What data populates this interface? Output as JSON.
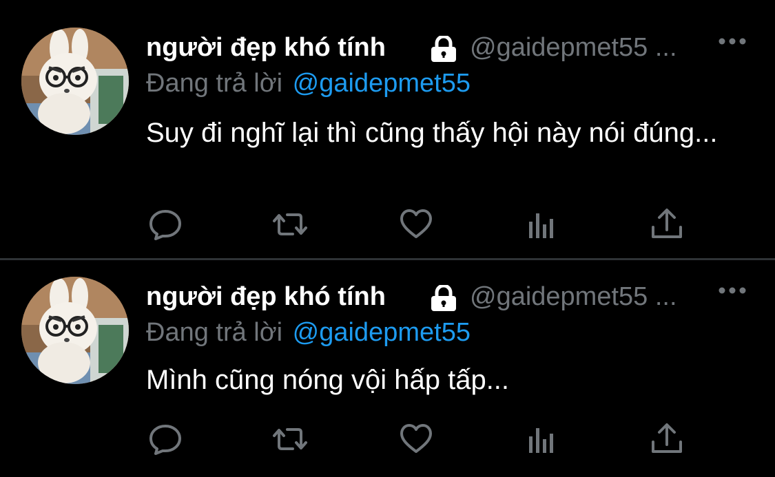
{
  "tweets": [
    {
      "author_name": "người đẹp khó tính",
      "handle": "@gaidepmet55 ...",
      "reply_prefix": "Đang trả lời",
      "reply_mention": "@gaidepmet55",
      "text": "Suy đi nghĩ lại thì cũng thấy hội này nói đúng..."
    },
    {
      "author_name": "người đẹp khó tính",
      "handle": "@gaidepmet55 ...",
      "reply_prefix": "Đang trả lời",
      "reply_mention": "@gaidepmet55",
      "text": "Mình cũng nóng vội hấp tấp..."
    }
  ],
  "icons": {
    "lock": "lock-icon",
    "more": "more-options-icon",
    "reply": "reply-icon",
    "retweet": "retweet-icon",
    "like": "heart-icon",
    "analytics": "analytics-icon",
    "share": "share-icon"
  },
  "colors": {
    "background": "#000000",
    "name": "#ffffff",
    "secondary": "#71767b",
    "mention": "#1d9bf0",
    "divider": "#2f3336"
  }
}
